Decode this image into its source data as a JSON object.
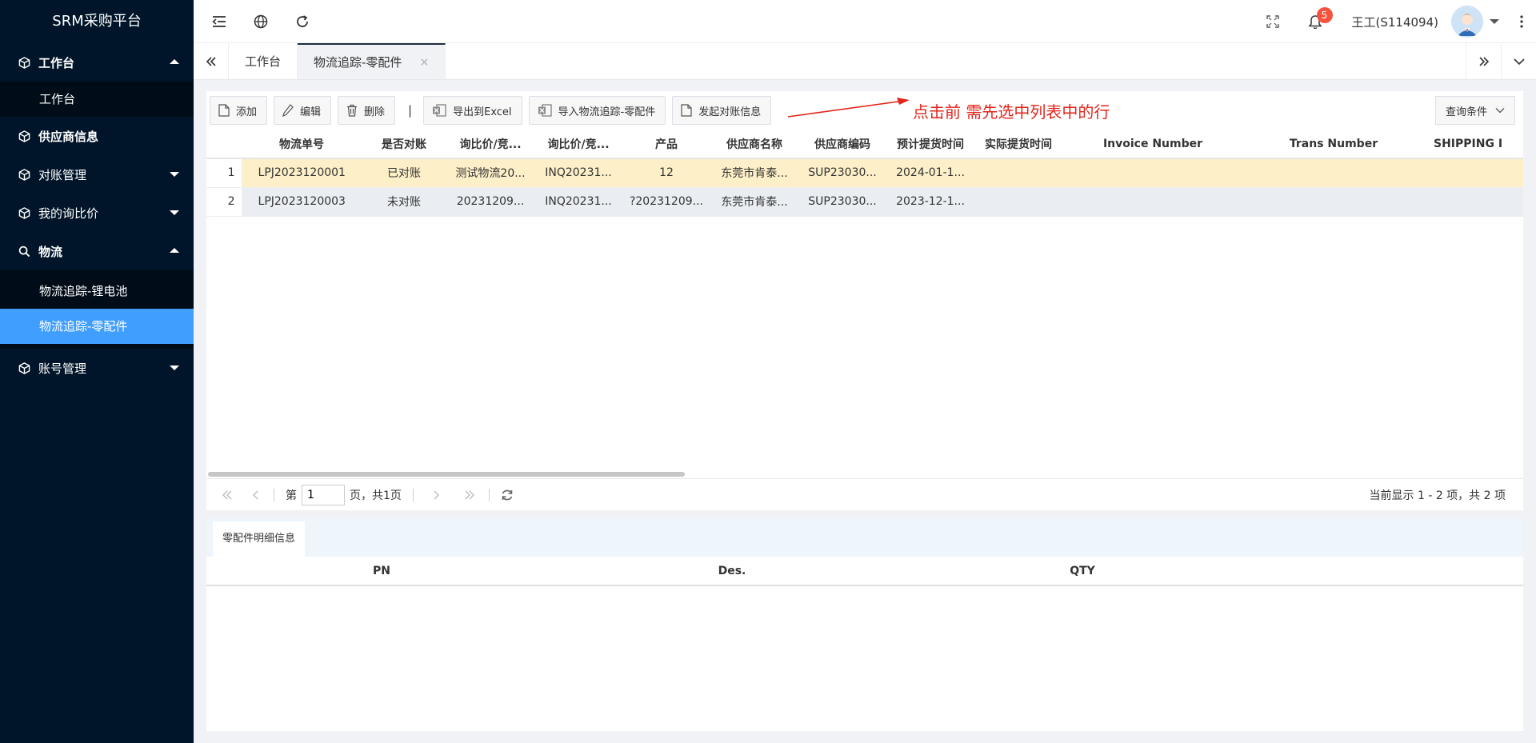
{
  "app": {
    "title": "SRM采购平台"
  },
  "sidebar": {
    "items": [
      {
        "label": "工作台",
        "expanded": true,
        "children": [
          {
            "label": "工作台",
            "active": false
          }
        ]
      },
      {
        "label": "供应商信息"
      },
      {
        "label": "对账管理"
      },
      {
        "label": "我的询比价"
      },
      {
        "label": "物流",
        "expanded": true,
        "children": [
          {
            "label": "物流追踪-锂电池",
            "active": false
          },
          {
            "label": "物流追踪-零配件",
            "active": true
          }
        ]
      },
      {
        "label": "账号管理"
      }
    ]
  },
  "header": {
    "notification_count": "5",
    "user_name": "王工(S114094)"
  },
  "tabs": [
    {
      "label": "工作台"
    },
    {
      "label": "物流追踪-零配件",
      "close": "×"
    }
  ],
  "toolbar": {
    "add": "添加",
    "edit": "编辑",
    "delete": "删除",
    "separator": "|",
    "export_excel": "导出到Excel",
    "import": "导入物流追踪-零配件",
    "reconcile": "发起对账信息",
    "annotation": "点击前 需先选中列表中的行",
    "query": "查询条件"
  },
  "table": {
    "columns": [
      "物流单号",
      "是否对账",
      "询比价/竞...",
      "询比价/竞...",
      "产品",
      "供应商名称",
      "供应商编码",
      "预计提货时间",
      "实际提货时间",
      "Invoice Number",
      "Trans Number",
      "SHIPPING I"
    ],
    "rows": [
      {
        "index": "1",
        "cells": [
          "LPJ2023120001",
          "已对账",
          "测试物流20...",
          "INQ20231...",
          "12",
          "东莞市肯泰...",
          "SUP23030...",
          "2024-01-1...",
          "",
          "",
          "",
          ""
        ]
      },
      {
        "index": "2",
        "cells": [
          "LPJ2023120003",
          "未对账",
          "20231209...",
          "INQ20231...",
          "?20231209...",
          "东莞市肯泰...",
          "SUP23030...",
          "2023-12-1...",
          "",
          "",
          "",
          ""
        ]
      }
    ]
  },
  "pager": {
    "page_label": "第",
    "page_value": "1",
    "page_total": "页，共1页",
    "info": "当前显示 1 - 2 项，共 2 项"
  },
  "detail": {
    "tab": "零配件明细信息",
    "columns": [
      "PN",
      "Des.",
      "QTY"
    ]
  },
  "colors": {
    "sidebar_bg": "#001529",
    "active_menu": "#409eff",
    "selected_row": "#fdf0c8",
    "annotation": "#e1251b"
  }
}
